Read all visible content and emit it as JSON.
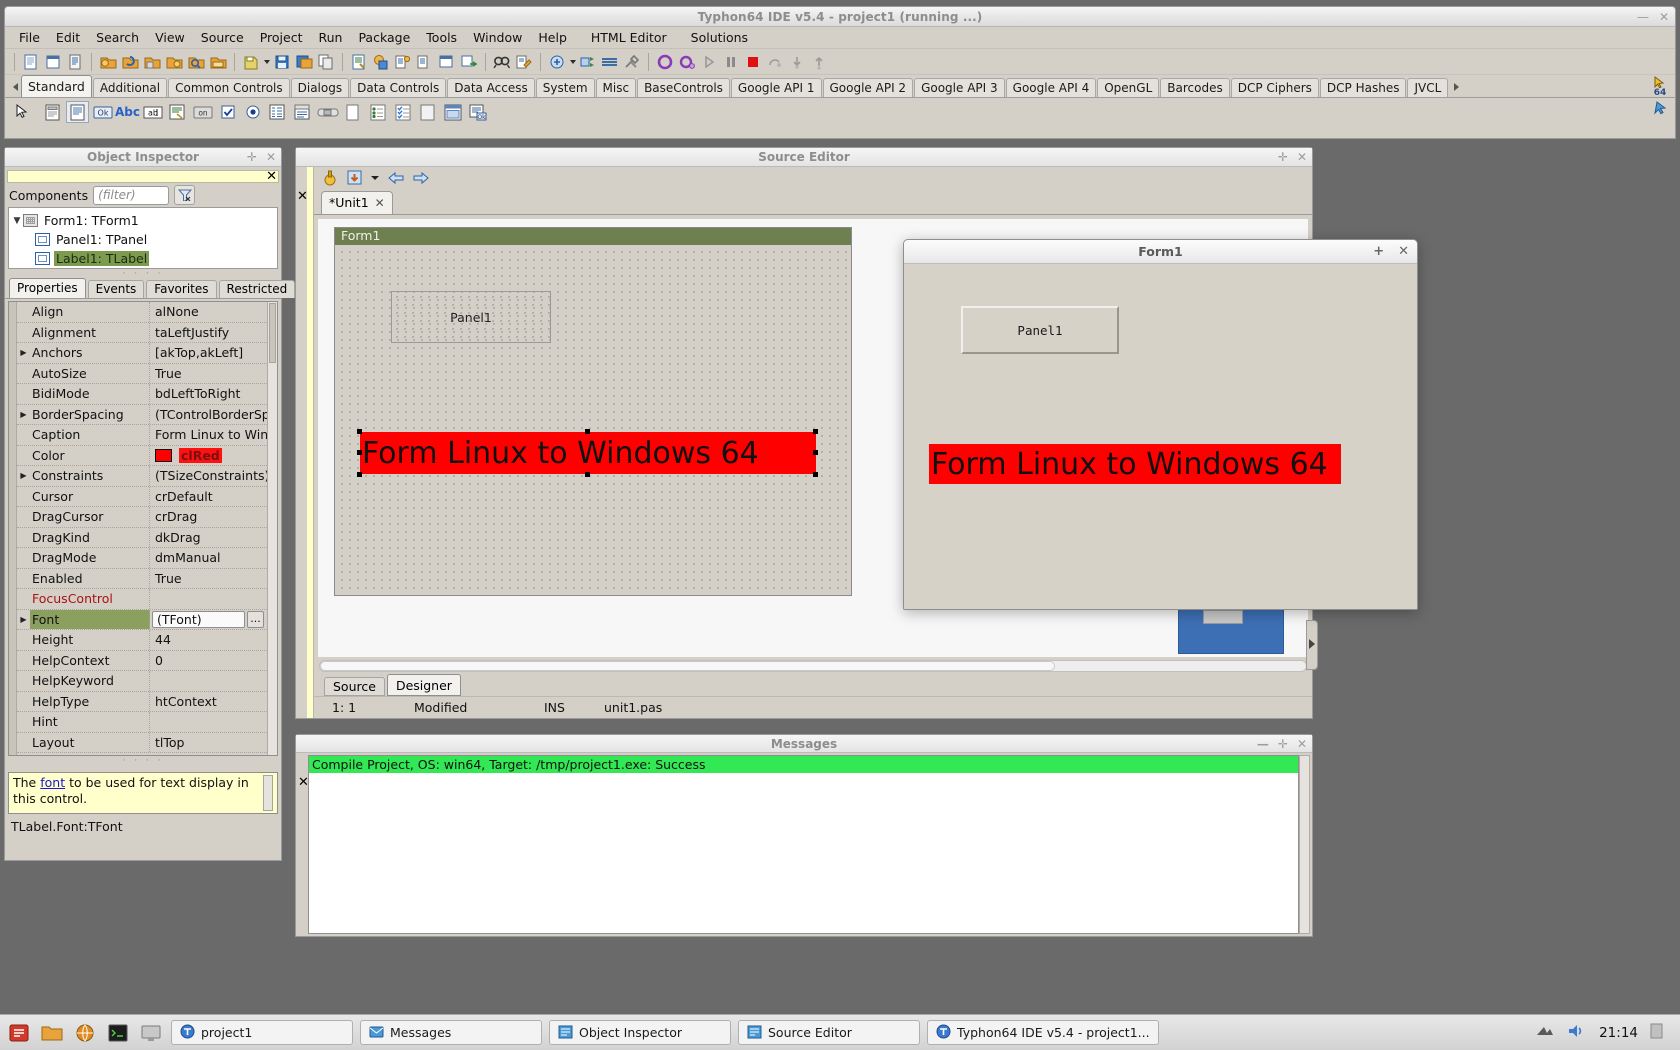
{
  "window": {
    "title": "Typhon64 IDE v5.4 - project1 (running ...)",
    "min": "—",
    "max": "□",
    "close": "✕"
  },
  "menu": {
    "items": [
      "File",
      "Edit",
      "Search",
      "View",
      "Source",
      "Project",
      "Run",
      "Package",
      "Tools",
      "Window",
      "Help",
      "HTML Editor",
      "Solutions"
    ]
  },
  "palette": {
    "tabs": [
      "Standard",
      "Additional",
      "Common Controls",
      "Dialogs",
      "Data Controls",
      "Data Access",
      "System",
      "Misc",
      "BaseControls",
      "Google API 1",
      "Google API 2",
      "Google API 3",
      "Google API 4",
      "OpenGL",
      "Barcodes",
      "DCP Ciphers",
      "DCP Hashes",
      "JVCL"
    ],
    "active_tab": "Standard",
    "badge": "64",
    "components": [
      "pointer-tool",
      "tframe",
      "tmainmenu",
      "tbutton-ok",
      "tlabel-abc",
      "tedit",
      "tmemo",
      "ttogglebox-on",
      "tcheckbox",
      "tradiobutton",
      "tlistbox",
      "tcombobox",
      "tscrollbar",
      "tgroupbox",
      "tradiogroup",
      "tchecklistbox",
      "tpanel",
      "tactionlist",
      "tframe-ok"
    ]
  },
  "object_inspector": {
    "title": "Object Inspector",
    "components_label": "Components",
    "filter_placeholder": "(filter)",
    "tree": [
      {
        "label": "Form1: TForm1",
        "level": 0,
        "selected": false
      },
      {
        "label": "Panel1: TPanel",
        "level": 1,
        "selected": false
      },
      {
        "label": "Label1: TLabel",
        "level": 1,
        "selected": true
      }
    ],
    "tabs": [
      "Properties",
      "Events",
      "Favorites",
      "Restricted"
    ],
    "active_tab": "Properties",
    "properties": [
      {
        "name": "Align",
        "value": "alNone",
        "expandable": false
      },
      {
        "name": "Alignment",
        "value": "taLeftJustify",
        "expandable": false
      },
      {
        "name": "Anchors",
        "value": "[akTop,akLeft]",
        "expandable": true
      },
      {
        "name": "AutoSize",
        "value": "True",
        "expandable": false
      },
      {
        "name": "BidiMode",
        "value": "bdLeftToRight",
        "expandable": false
      },
      {
        "name": "BorderSpacing",
        "value": "(TControlBorderSpacin",
        "expandable": true
      },
      {
        "name": "Caption",
        "value": "Form Linux to Windows",
        "expandable": false
      },
      {
        "name": "Color",
        "value": "clRed",
        "expandable": false,
        "kind": "color",
        "swatch": "#ff0000"
      },
      {
        "name": "Constraints",
        "value": "(TSizeConstraints)",
        "expandable": true
      },
      {
        "name": "Cursor",
        "value": "crDefault",
        "expandable": false
      },
      {
        "name": "DragCursor",
        "value": "crDrag",
        "expandable": false
      },
      {
        "name": "DragKind",
        "value": "dkDrag",
        "expandable": false
      },
      {
        "name": "DragMode",
        "value": "dmManual",
        "expandable": false
      },
      {
        "name": "Enabled",
        "value": "True",
        "expandable": false
      },
      {
        "name": "FocusControl",
        "value": "",
        "expandable": false,
        "kind": "red-name"
      },
      {
        "name": "Font",
        "value": "(TFont)",
        "expandable": true,
        "kind": "editor",
        "selected": true,
        "dots": "..."
      },
      {
        "name": "Height",
        "value": "44",
        "expandable": false
      },
      {
        "name": "HelpContext",
        "value": "0",
        "expandable": false
      },
      {
        "name": "HelpKeyword",
        "value": "",
        "expandable": false
      },
      {
        "name": "HelpType",
        "value": "htContext",
        "expandable": false
      },
      {
        "name": "Hint",
        "value": "",
        "expandable": false
      },
      {
        "name": "Layout",
        "value": "tlTop",
        "expandable": false
      }
    ],
    "hint": {
      "prefix": "The ",
      "link": "font",
      "suffix": " to be used for text display in this control."
    },
    "status": "TLabel.Font:TFont"
  },
  "source_editor": {
    "title": "Source Editor",
    "tab_label": "*Unit1",
    "tab_close": "✕",
    "bottom_tabs": [
      "Source",
      "Designer"
    ],
    "active_bottom_tab": "Designer",
    "status": {
      "caret": "1: 1",
      "modified": "Modified",
      "insert_mode": "INS",
      "file": "unit1.pas"
    },
    "designer": {
      "form_title": "Form1",
      "panel_caption": "Panel1",
      "label_caption": "Form Linux to Windows 64",
      "label_bg": "#ff0000"
    }
  },
  "messages": {
    "title": "Messages",
    "lines": [
      "Compile Project, OS: win64, Target: /tmp/project1.exe: Success"
    ],
    "success_color": "#33e855"
  },
  "running_form": {
    "title": "Form1",
    "panel_caption": "Panel1",
    "label_caption": "Form Linux to Windows 64",
    "label_bg": "#ff0000",
    "btn_max": "+",
    "btn_close": "✕"
  },
  "taskbar": {
    "buttons": [
      {
        "label": "project1",
        "icon": "typhon-icon"
      },
      {
        "label": "Messages",
        "icon": "messages-icon"
      },
      {
        "label": "Object Inspector",
        "icon": "inspector-icon"
      },
      {
        "label": "Source Editor",
        "icon": "editor-icon"
      },
      {
        "label": "Typhon64 IDE v5.4 - project1...",
        "icon": "typhon-icon"
      }
    ],
    "clock": "21:14"
  }
}
